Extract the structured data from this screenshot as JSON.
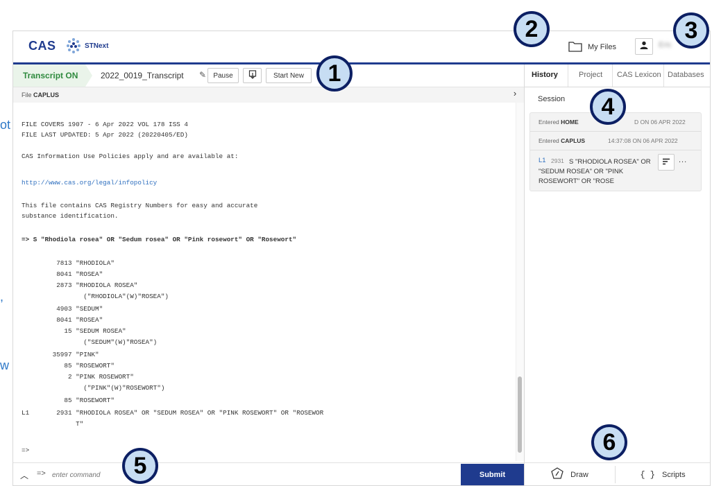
{
  "edge_fragments": [
    "ot",
    ",",
    "w"
  ],
  "app": {
    "logo_text": "CAS",
    "product": "STNext",
    "my_files": "My Files",
    "username": "Eric"
  },
  "transcript": {
    "status": "Transcript ON",
    "name": "2022_0019_Transcript",
    "pause": "Pause",
    "start_new": "Start New"
  },
  "file_line": {
    "label": "File",
    "value": "CAPLUS"
  },
  "console_lines": [
    "FILE COVERS 1907 - 6 Apr 2022 VOL 178 ISS 4",
    "FILE LAST UPDATED: 5 Apr 2022 (20220405/ED)",
    "CAS Information Use Policies apply and are available at:",
    "http://www.cas.org/legal/infopolicy",
    "This file contains CAS Registry Numbers for easy and accurate",
    "substance identification.",
    "=> S \"Rhodiola rosea\" OR \"Sedum rosea\" OR \"Pink rosewort\" OR \"Rosewort\"",
    "         7813 \"RHODIOLA\"",
    "         8041 \"ROSEA\"",
    "         2873 \"RHODIOLA ROSEA\"",
    "                (\"RHODIOLA\"(W)\"ROSEA\")",
    "         4903 \"SEDUM\"",
    "         8041 \"ROSEA\"",
    "           15 \"SEDUM ROSEA\"",
    "                (\"SEDUM\"(W)\"ROSEA\")",
    "        35997 \"PINK\"",
    "           85 \"ROSEWORT\"",
    "            2 \"PINK ROSEWORT\"",
    "                (\"PINK\"(W)\"ROSEWORT\")",
    "           85 \"ROSEWORT\"",
    "L1       2931 \"RHODIOLA ROSEA\" OR \"SEDUM ROSEA\" OR \"PINK ROSEWORT\" OR \"ROSEWOR",
    "              T\"",
    "=>"
  ],
  "command": {
    "prompt": "=>",
    "placeholder": "enter command",
    "submit": "Submit"
  },
  "right_panel": {
    "tabs": [
      "History",
      "Project",
      "CAS Lexicon",
      "Databases"
    ],
    "session_label": "Session",
    "history": [
      {
        "prefix": "Entered",
        "db": "HOME",
        "time": "D ON 06 APR 2022"
      },
      {
        "prefix": "Entered",
        "db": "CAPLUS",
        "time": "14:37:08 ON 06 APR 2022"
      }
    ],
    "query": {
      "id": "L1",
      "count": "2931",
      "text": "S \"RHODIOLA ROSEA\" OR \"SEDUM ROSEA\" OR \"PINK ROSEWORT\" OR \"ROSE",
      "more": "..."
    },
    "draw": "Draw",
    "scripts_icon": "{ }",
    "scripts": "Scripts"
  },
  "callouts": [
    "1",
    "2",
    "3",
    "4",
    "5",
    "6"
  ],
  "colors": {
    "brand": "#1f3b8e",
    "transcript_green": "#2f8a3e",
    "link": "#2e6fbf",
    "callout_fill": "#c7ddf3"
  }
}
